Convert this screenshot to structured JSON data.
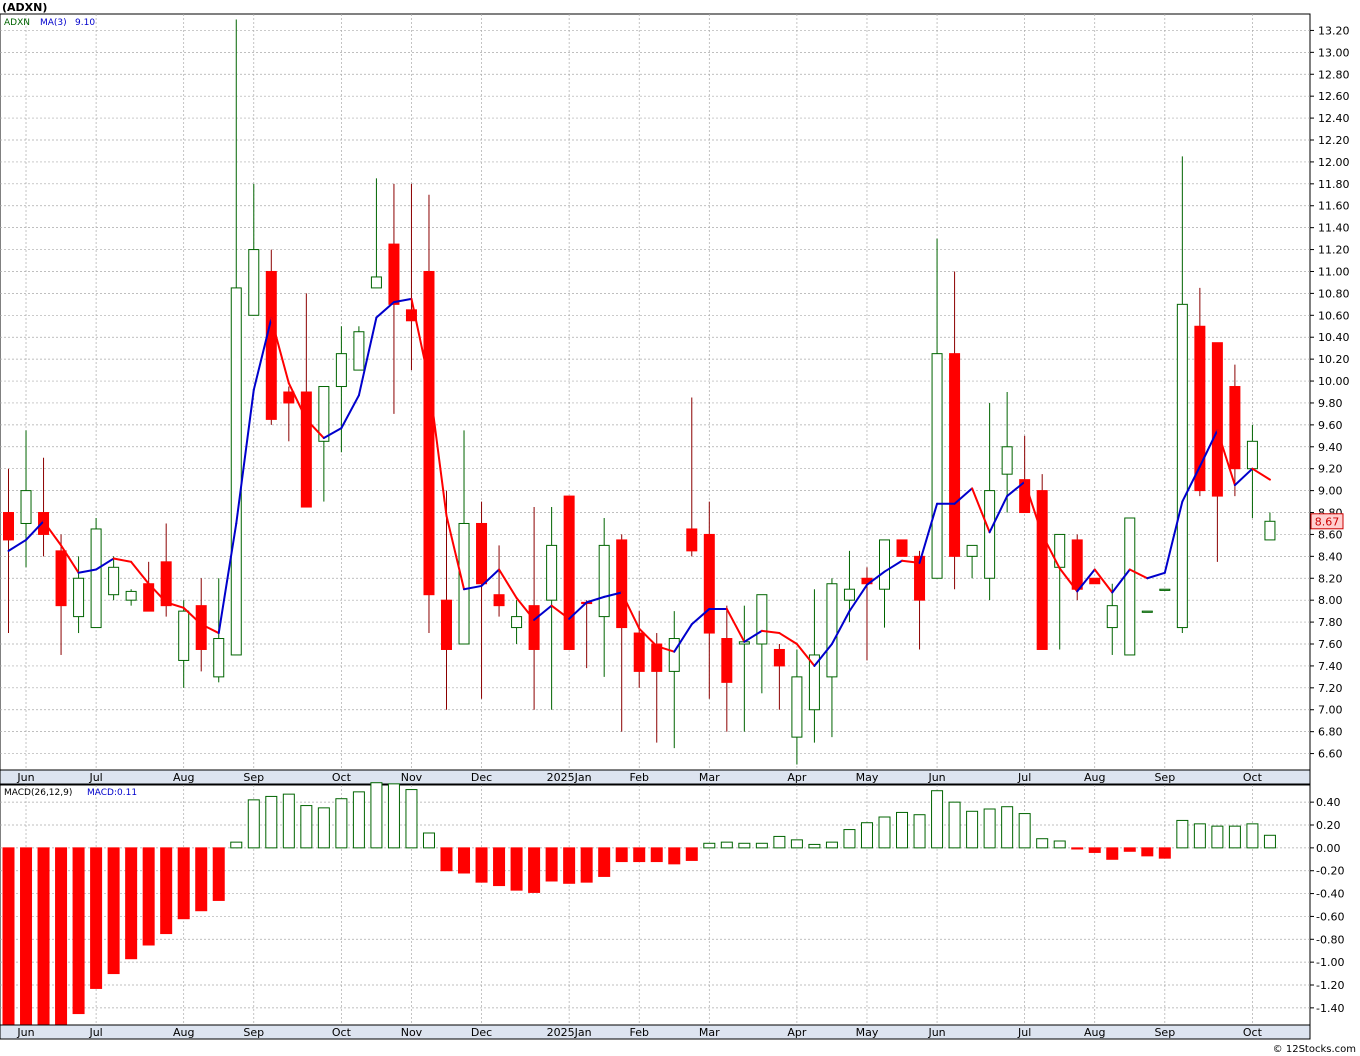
{
  "title": "(ADXN)",
  "footer": "© 12Stocks.com",
  "price_legend": {
    "symbol": "ADXN",
    "ma_label": "MA(3)",
    "ma_value": "9.10"
  },
  "macd_legend": {
    "label": "MACD(26,12,9)",
    "value_label": "MACD:0.11"
  },
  "last_price_label": "8.67",
  "colors": {
    "up": "#006400",
    "down": "#ff0000",
    "ma_up": "#0000cc",
    "ma_down": "#ff0000",
    "grid": "#aaaaaa",
    "axis_bg": "#dde4f0"
  },
  "chart_data": [
    {
      "type": "candlestick",
      "series_name": "ADXN",
      "ylim": [
        6.45,
        13.35
      ],
      "yticks": [
        6.6,
        6.8,
        7.0,
        7.2,
        7.4,
        7.6,
        7.8,
        8.0,
        8.2,
        8.4,
        8.6,
        8.8,
        9.0,
        9.2,
        9.4,
        9.6,
        9.8,
        10.0,
        10.2,
        10.4,
        10.6,
        10.8,
        11.0,
        11.2,
        11.4,
        11.6,
        11.8,
        12.0,
        12.2,
        12.4,
        12.6,
        12.8,
        13.0,
        13.2
      ],
      "x_tick_labels": [
        "Jun",
        "Jul",
        "Aug",
        "Sep",
        "Oct",
        "Nov",
        "Dec",
        "2025Jan",
        "Feb",
        "Mar",
        "Apr",
        "May",
        "Jun",
        "Jul",
        "Aug",
        "Sep",
        "Oct"
      ],
      "x_tick_weeks": [
        1,
        5,
        10,
        14,
        19,
        23,
        27,
        32,
        36,
        40,
        45,
        49,
        53,
        58,
        62,
        66,
        71
      ],
      "candles": [
        [
          8.8,
          9.2,
          7.7,
          8.55
        ],
        [
          8.7,
          9.55,
          8.3,
          9.0
        ],
        [
          8.8,
          9.3,
          8.4,
          8.6
        ],
        [
          8.45,
          8.6,
          7.5,
          7.95
        ],
        [
          7.85,
          8.4,
          7.7,
          8.2
        ],
        [
          7.75,
          8.75,
          7.75,
          8.65
        ],
        [
          8.05,
          8.4,
          8.0,
          8.3
        ],
        [
          8.0,
          8.1,
          7.95,
          8.08
        ],
        [
          8.15,
          8.35,
          7.95,
          7.9
        ],
        [
          8.35,
          8.7,
          7.85,
          7.95
        ],
        [
          7.45,
          8.0,
          7.2,
          7.9
        ],
        [
          7.95,
          8.2,
          7.35,
          7.55
        ],
        [
          7.3,
          8.2,
          7.25,
          7.65
        ],
        [
          7.5,
          13.3,
          7.5,
          10.85
        ],
        [
          10.6,
          11.8,
          10.6,
          11.2
        ],
        [
          11.0,
          11.2,
          9.6,
          9.65
        ],
        [
          9.9,
          9.95,
          9.45,
          9.8
        ],
        [
          9.9,
          10.8,
          8.9,
          8.85
        ],
        [
          9.45,
          9.95,
          8.9,
          9.95
        ],
        [
          9.95,
          10.5,
          9.35,
          10.25
        ],
        [
          10.1,
          10.5,
          10.1,
          10.45
        ],
        [
          10.85,
          11.85,
          10.85,
          10.95
        ],
        [
          11.25,
          11.8,
          9.7,
          10.7
        ],
        [
          10.65,
          11.8,
          10.1,
          10.55
        ],
        [
          11.0,
          11.7,
          7.7,
          8.05
        ],
        [
          8.0,
          9.0,
          7.0,
          7.55
        ],
        [
          7.6,
          9.55,
          7.6,
          8.7
        ],
        [
          8.7,
          8.9,
          7.1,
          8.15
        ],
        [
          8.05,
          8.5,
          7.85,
          7.95
        ],
        [
          7.75,
          8.0,
          7.6,
          7.85
        ],
        [
          7.95,
          8.85,
          7.0,
          7.55
        ],
        [
          8.0,
          8.85,
          7.0,
          8.5
        ],
        [
          8.95,
          8.95,
          7.55,
          7.55
        ],
        [
          7.98,
          8.0,
          7.38,
          7.97
        ],
        [
          7.85,
          8.75,
          7.3,
          8.5
        ],
        [
          8.55,
          8.6,
          6.8,
          7.75
        ],
        [
          7.7,
          7.9,
          7.2,
          7.35
        ],
        [
          7.6,
          7.7,
          6.7,
          7.35
        ],
        [
          7.35,
          7.9,
          6.65,
          7.65
        ],
        [
          8.65,
          9.85,
          8.4,
          8.45
        ],
        [
          8.6,
          8.9,
          7.1,
          7.7
        ],
        [
          7.65,
          7.95,
          6.8,
          7.25
        ],
        [
          7.6,
          7.95,
          6.8,
          7.62
        ],
        [
          7.6,
          8.05,
          7.15,
          8.05
        ],
        [
          7.55,
          7.6,
          7.0,
          7.4
        ],
        [
          6.75,
          7.55,
          6.5,
          7.3
        ],
        [
          7.0,
          8.1,
          6.7,
          7.5
        ],
        [
          7.3,
          8.2,
          6.75,
          8.15
        ],
        [
          8.0,
          8.45,
          7.8,
          8.1
        ],
        [
          8.2,
          8.3,
          7.45,
          8.15
        ],
        [
          8.1,
          8.55,
          7.75,
          8.55
        ],
        [
          8.55,
          8.55,
          8.4,
          8.4
        ],
        [
          8.4,
          8.45,
          7.55,
          8.0
        ],
        [
          8.2,
          11.3,
          8.2,
          10.25
        ],
        [
          10.25,
          11.0,
          8.1,
          8.4
        ],
        [
          8.4,
          8.5,
          8.2,
          8.5
        ],
        [
          8.2,
          9.8,
          8.0,
          9.0
        ],
        [
          9.15,
          9.9,
          8.8,
          9.4
        ],
        [
          9.1,
          9.5,
          8.8,
          8.8
        ],
        [
          9.0,
          9.15,
          7.55,
          7.55
        ],
        [
          8.3,
          8.6,
          7.55,
          8.6
        ],
        [
          8.55,
          8.6,
          8.0,
          8.1
        ],
        [
          8.2,
          8.2,
          8.15,
          8.15
        ],
        [
          7.75,
          8.15,
          7.5,
          7.95
        ],
        [
          7.5,
          8.75,
          7.5,
          8.75
        ],
        [
          7.9,
          7.9,
          7.9,
          7.9
        ],
        [
          8.1,
          8.1,
          8.1,
          8.1
        ],
        [
          7.75,
          12.05,
          7.7,
          10.7
        ],
        [
          10.5,
          10.85,
          8.95,
          9.0
        ],
        [
          10.35,
          10.35,
          8.35,
          8.95
        ],
        [
          9.95,
          10.15,
          8.95,
          9.2
        ],
        [
          9.2,
          9.6,
          8.75,
          9.45
        ],
        [
          8.55,
          8.8,
          8.55,
          8.72
        ]
      ],
      "ma3": [
        8.45,
        8.55,
        8.72,
        8.5,
        8.25,
        8.28,
        8.38,
        8.35,
        8.15,
        7.98,
        7.93,
        7.78,
        7.7,
        8.7,
        9.92,
        10.57,
        9.98,
        9.65,
        9.48,
        9.57,
        9.87,
        10.58,
        10.72,
        10.75,
        10.0,
        8.77,
        8.1,
        8.13,
        8.28,
        8.02,
        7.82,
        7.95,
        7.83,
        7.98,
        8.03,
        8.07,
        7.74,
        7.58,
        7.53,
        7.78,
        7.92,
        7.92,
        7.62,
        7.72,
        7.7,
        7.6,
        7.4,
        7.6,
        7.9,
        8.14,
        8.26,
        8.36,
        8.34,
        8.88,
        8.88,
        9.02,
        8.62,
        8.95,
        9.08,
        8.6,
        8.29,
        8.08,
        8.28,
        8.07,
        8.28,
        8.2,
        8.25,
        8.9,
        9.22,
        9.55,
        9.05,
        9.2,
        9.1
      ]
    },
    {
      "type": "bar",
      "series_name": "MACD",
      "ylim": [
        -1.55,
        0.55
      ],
      "yticks": [
        -1.4,
        -1.2,
        -1.0,
        -0.8,
        -0.6,
        -0.4,
        -0.2,
        0.0,
        0.2,
        0.4
      ],
      "x_tick_labels": [
        "Jun",
        "Jul",
        "Aug",
        "Sep",
        "Oct",
        "Nov",
        "Dec",
        "2025Jan",
        "Feb",
        "Mar",
        "Apr",
        "May",
        "Jun",
        "Jul",
        "Aug",
        "Sep",
        "Oct"
      ],
      "values": [
        -1.55,
        -1.55,
        -1.55,
        -1.55,
        -1.45,
        -1.23,
        -1.1,
        -0.97,
        -0.85,
        -0.75,
        -0.62,
        -0.55,
        -0.46,
        0.05,
        0.42,
        0.45,
        0.47,
        0.37,
        0.35,
        0.43,
        0.49,
        0.57,
        0.56,
        0.51,
        0.13,
        -0.2,
        -0.22,
        -0.3,
        -0.33,
        -0.37,
        -0.39,
        -0.29,
        -0.31,
        -0.3,
        -0.25,
        -0.12,
        -0.12,
        -0.12,
        -0.14,
        -0.11,
        0.04,
        0.05,
        0.04,
        0.04,
        0.1,
        0.07,
        0.03,
        0.05,
        0.16,
        0.22,
        0.27,
        0.31,
        0.29,
        0.5,
        0.4,
        0.32,
        0.34,
        0.36,
        0.3,
        0.08,
        0.06,
        -0.01,
        -0.04,
        -0.1,
        -0.03,
        -0.07,
        -0.09,
        0.24,
        0.21,
        0.19,
        0.19,
        0.21,
        0.11
      ]
    }
  ]
}
